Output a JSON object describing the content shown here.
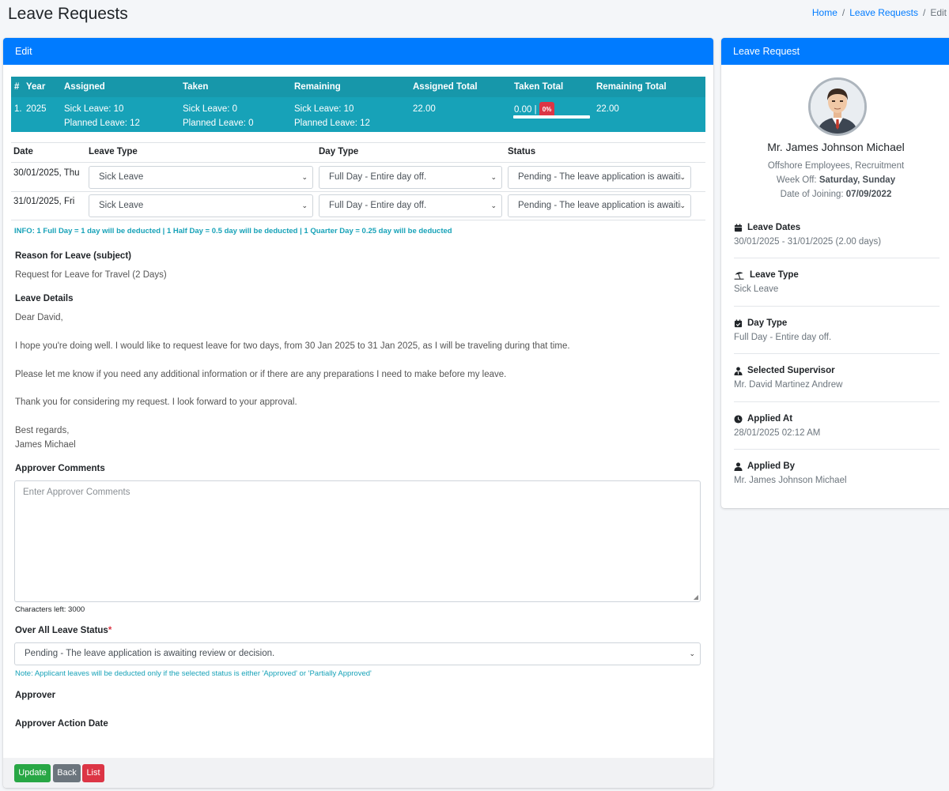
{
  "page": {
    "title": "Leave Requests",
    "breadcrumb": [
      "Home",
      "Leave Requests",
      "Edit"
    ]
  },
  "edit_card": {
    "header": "Edit",
    "summary": {
      "headers": [
        "#",
        "Year",
        "Assigned",
        "Taken",
        "Remaining",
        "Assigned Total",
        "Taken Total",
        "Remaining Total"
      ],
      "row": {
        "index": "1.",
        "year": "2025",
        "assigned": [
          "Sick Leave: 10",
          "Planned Leave: 12"
        ],
        "taken": [
          "Sick Leave: 0",
          "Planned Leave: 0"
        ],
        "remaining": [
          "Sick Leave: 10",
          "Planned Leave: 12"
        ],
        "assigned_total": "22.00",
        "taken_total": "0.00 |",
        "taken_badge": "0%",
        "taken_progress_pct": 0,
        "remaining_total": "22.00"
      }
    },
    "dates_table": {
      "headers": [
        "Date",
        "Leave Type",
        "Day Type",
        "Status"
      ],
      "rows": [
        {
          "date": "30/01/2025, Thu",
          "leave_type": "Sick Leave",
          "day_type": "Full Day - Entire day off.",
          "status": "Pending - The leave application is awaiting review or decision."
        },
        {
          "date": "31/01/2025, Fri",
          "leave_type": "Sick Leave",
          "day_type": "Full Day - Entire day off.",
          "status": "Pending - The leave application is awaiting review or decision."
        }
      ]
    },
    "info": "INFO: 1 Full Day = 1 day will be deducted | 1 Half Day = 0.5 day will be deducted | 1 Quarter Day = 0.25 day will be deducted",
    "reason_label": "Reason for Leave (subject)",
    "reason_value": "Request for Leave for Travel (2 Days)",
    "details_label": "Leave Details",
    "details": [
      "Dear David,",
      "I hope you're doing well. I would like to request leave for two days, from 30 Jan 2025 to 31 Jan 2025, as I will be traveling during that time.",
      "Please let me know if you need any additional information or if there are any preparations I need to make before my leave.",
      "Thank you for considering my request. I look forward to your approval.",
      "Best regards,",
      "James Michael"
    ],
    "approver_comments_label": "Approver Comments",
    "approver_comments_placeholder": "Enter Approver Comments",
    "chars_left": "Characters left: 3000",
    "overall_status_label": "Over All Leave Status",
    "overall_status_required": "*",
    "overall_status_value": "Pending - The leave application is awaiting review or decision.",
    "note": "Note: Applicant leaves will be deducted only if the selected status is either 'Approved' or 'Partially Approved'",
    "approver_label": "Approver",
    "approver_action_date_label": "Approver Action Date",
    "buttons": {
      "update": "Update",
      "back": "Back",
      "list": "List"
    }
  },
  "profile_card": {
    "header": "Leave Request",
    "name": "Mr. James Johnson Michael",
    "department": "Offshore Employees, Recruitment",
    "week_off_label": "Week Off:",
    "week_off_value": "Saturday, Sunday",
    "doj_label": "Date of Joining:",
    "doj_value": "07/09/2022",
    "items": [
      {
        "icon": "calendar-icon",
        "title": "Leave Dates",
        "value": "30/01/2025 - 31/01/2025 (2.00 days)"
      },
      {
        "icon": "umbrella-beach-icon",
        "title": "Leave Type",
        "value": "Sick Leave"
      },
      {
        "icon": "calendar-check-icon",
        "title": "Day Type",
        "value": "Full Day - Entire day off."
      },
      {
        "icon": "supervisor-icon",
        "title": "Selected Supervisor",
        "value": "Mr. David Martinez Andrew"
      },
      {
        "icon": "clock-icon",
        "title": "Applied At",
        "value": "28/01/2025 02:12 AM"
      },
      {
        "icon": "user-icon",
        "title": "Applied By",
        "value": "Mr. James Johnson Michael"
      }
    ]
  },
  "colors": {
    "primary": "#007bff",
    "info": "#17a2b8",
    "success": "#28a745",
    "secondary": "#6c757d",
    "danger": "#dc3545"
  }
}
